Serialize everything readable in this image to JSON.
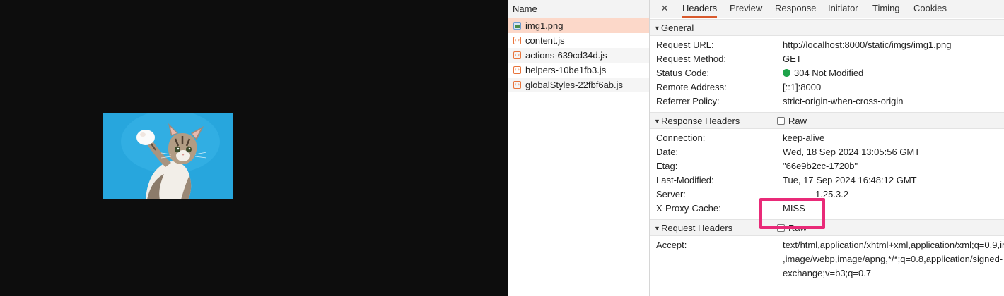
{
  "name_panel": {
    "header": "Name",
    "files": [
      {
        "name": "img1.png",
        "type": "image",
        "selected": true
      },
      {
        "name": "content.js",
        "type": "script",
        "selected": false
      },
      {
        "name": "actions-639cd34d.js",
        "type": "script",
        "selected": false
      },
      {
        "name": "helpers-10be1fb3.js",
        "type": "script",
        "selected": false
      },
      {
        "name": "globalStyles-22fbf6ab.js",
        "type": "script",
        "selected": false
      }
    ]
  },
  "tabs": {
    "close": "×",
    "headers": "Headers",
    "preview": "Preview",
    "response": "Response",
    "initiator": "Initiator",
    "timing": "Timing",
    "cookies": "Cookies",
    "active": "Headers"
  },
  "general": {
    "title": "General",
    "rows": [
      {
        "key": "Request URL:",
        "value": "http://localhost:8000/static/imgs/img1.png"
      },
      {
        "key": "Request Method:",
        "value": "GET"
      },
      {
        "key": "Status Code:",
        "value": "304 Not Modified"
      },
      {
        "key": "Remote Address:",
        "value": "[::1]:8000"
      },
      {
        "key": "Referrer Policy:",
        "value": "strict-origin-when-cross-origin"
      }
    ],
    "status_color": "#1ea34a"
  },
  "response_headers": {
    "title": "Response Headers",
    "raw_label": "Raw",
    "rows": [
      {
        "key": "Connection:",
        "value": "keep-alive"
      },
      {
        "key": "Date:",
        "value": "Wed, 18 Sep 2024 13:05:56 GMT"
      },
      {
        "key": "Etag:",
        "value": "\"66e9b2cc-1720b\""
      },
      {
        "key": "Last-Modified:",
        "value": "Tue, 17 Sep 2024 16:48:12 GMT"
      },
      {
        "key": "Server:",
        "value": "1.25.3.2"
      },
      {
        "key": "X-Proxy-Cache:",
        "value": "MISS"
      }
    ]
  },
  "request_headers": {
    "title": "Request Headers",
    "raw_label": "Raw",
    "rows": [
      {
        "key": "Accept:",
        "value": "text/html,application/xhtml+xml,application/xml;q=0.9,ir"
      },
      {
        "key": "",
        "value": ",image/webp,image/apng,*/*;q=0.8,application/signed-"
      },
      {
        "key": "",
        "value": "exchange;v=b3;q=0.7"
      }
    ]
  },
  "colors": {
    "highlight": "#e92a78",
    "active_tab": "#d85a2d",
    "selected_row": "#fcd8c9",
    "image_bg": "#2aa9e0"
  }
}
